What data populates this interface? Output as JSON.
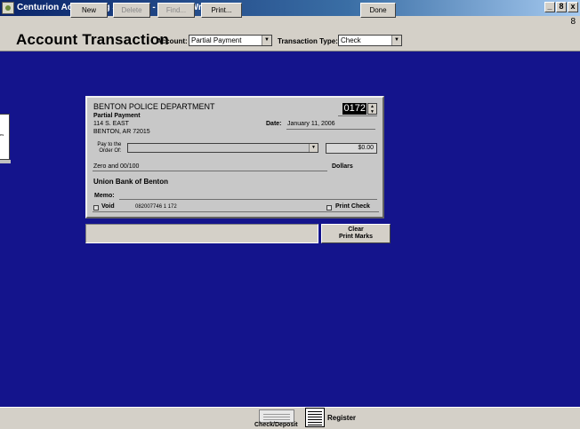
{
  "window": {
    "title": "Centurion Accounting Software - [Check Writer]",
    "buttons": {
      "minimize": "_",
      "restore": "8",
      "close": "x"
    },
    "restore_glyph": "8"
  },
  "header": {
    "title": "Account Transaction",
    "account_label": "Account:",
    "account_value": "Partial Payment",
    "transaction_type_label": "Transaction Type:",
    "transaction_type_value": "Check"
  },
  "check": {
    "payer_name": "BENTON POLICE DEPARTMENT",
    "payer_sub": "Partial Payment",
    "address1": "114 S. EAST",
    "address2": "BENTON, AR 72015",
    "check_number": "0172",
    "date_label": "Date:",
    "date_value": "January 11, 2006",
    "pay_to_line1": "Pay to the",
    "pay_to_line2": "Order Of:",
    "payee_value": "",
    "amount": "$0.00",
    "amount_words": "Zero and 00/100",
    "dollars_label": "Dollars",
    "bank_name": "Union Bank of Benton",
    "memo_label": "Memo:",
    "memo_value": "",
    "void_label": "Void",
    "void_checked": false,
    "micr_line": "082007746 1 172",
    "print_check_label": "Print Check",
    "print_check_checked": false
  },
  "clear_print_marks": {
    "line1": "Clear",
    "line2": "Print Marks"
  },
  "status_text": "",
  "toolbar": {
    "new": "New",
    "delete": "Delete",
    "find": "Find...",
    "print": "Print...",
    "check_deposit": "Check/Deposit",
    "register": "Register",
    "done": "Done"
  },
  "colors": {
    "background": "#14148c",
    "title_bar": "#0a246a",
    "chrome": "#d4d0c8",
    "check_face": "#c8c8c8"
  },
  "icons": [
    "app-icon",
    "chevron-down-icon",
    "spinner-icon",
    "check-deposit-icon",
    "register-icon",
    "checkbox-icon"
  ]
}
